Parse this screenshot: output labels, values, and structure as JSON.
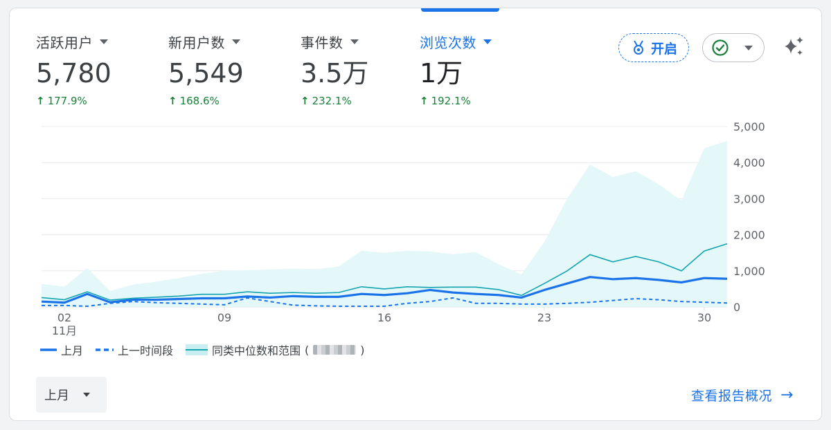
{
  "metrics": [
    {
      "label": "活跃用户",
      "value": "5,780",
      "change": "177.9%",
      "active": false
    },
    {
      "label": "新用户数",
      "value": "5,549",
      "change": "168.6%",
      "active": false
    },
    {
      "label": "事件数",
      "value": "3.5万",
      "change": "232.1%",
      "active": false
    },
    {
      "label": "浏览次数",
      "value": "1万",
      "change": "192.1%",
      "active": true
    }
  ],
  "toolbar": {
    "insights_label": "开启",
    "medal_icon": "medal-icon",
    "status_icon": "check-circle-icon",
    "sparkle_icon": "sparkle-icon"
  },
  "colors": {
    "accent": "#1a73e8",
    "positive": "#188038",
    "benchmark_line": "#12a4af",
    "benchmark_band": "#e4f7f9"
  },
  "chart_data": {
    "type": "line",
    "x_ticks": [
      "02",
      "09",
      "16",
      "23",
      "30"
    ],
    "x_month_label": "11月",
    "y_ticks": [
      "5,000",
      "4,000",
      "3,000",
      "2,000",
      "1,000",
      "0"
    ],
    "ylim": [
      0,
      5000
    ],
    "days": [
      1,
      2,
      3,
      4,
      5,
      6,
      7,
      8,
      9,
      10,
      11,
      12,
      13,
      14,
      15,
      16,
      17,
      18,
      19,
      20,
      21,
      22,
      23,
      24,
      25,
      26,
      27,
      28,
      29,
      30,
      31
    ],
    "series": [
      {
        "name": "上月",
        "style": "solid",
        "values": [
          150,
          120,
          360,
          130,
          200,
          200,
          220,
          240,
          240,
          290,
          260,
          300,
          280,
          280,
          360,
          330,
          380,
          470,
          400,
          360,
          330,
          260,
          470,
          650,
          830,
          770,
          800,
          750,
          680,
          800,
          780
        ]
      },
      {
        "name": "上一时间段",
        "style": "dashed",
        "values": [
          40,
          40,
          20,
          100,
          150,
          120,
          100,
          80,
          60,
          250,
          150,
          50,
          30,
          20,
          20,
          20,
          100,
          150,
          250,
          100,
          100,
          80,
          80,
          100,
          130,
          180,
          230,
          200,
          150,
          130,
          110
        ]
      },
      {
        "name": "同类中位数和范围",
        "style": "band",
        "median": [
          260,
          200,
          420,
          190,
          240,
          270,
          300,
          350,
          350,
          420,
          380,
          400,
          380,
          400,
          560,
          500,
          560,
          540,
          550,
          550,
          480,
          320,
          650,
          1000,
          1450,
          1250,
          1400,
          1250,
          1000,
          1550,
          1750
        ],
        "upper": [
          640,
          560,
          1080,
          440,
          620,
          700,
          800,
          920,
          1000,
          1020,
          1040,
          1060,
          1050,
          1120,
          1560,
          1500,
          1560,
          1540,
          1460,
          1520,
          1180,
          900,
          1800,
          3000,
          3950,
          3600,
          3760,
          3400,
          2950,
          4400,
          4600
        ],
        "lower": [
          20,
          0,
          0,
          0,
          0,
          0,
          0,
          0,
          0,
          0,
          0,
          0,
          0,
          0,
          0,
          0,
          0,
          0,
          0,
          0,
          0,
          0,
          0,
          0,
          0,
          0,
          0,
          0,
          0,
          0,
          0
        ]
      }
    ],
    "grid": true,
    "legend_position": "bottom-left"
  },
  "legend": {
    "item1": "上月",
    "item2": "上一时间段",
    "item3": "同类中位数和范围",
    "open_paren": "(",
    "close_paren": ")"
  },
  "range_select": {
    "value": "上月"
  },
  "report_link": {
    "label": "查看报告概况",
    "arrow": "→"
  }
}
